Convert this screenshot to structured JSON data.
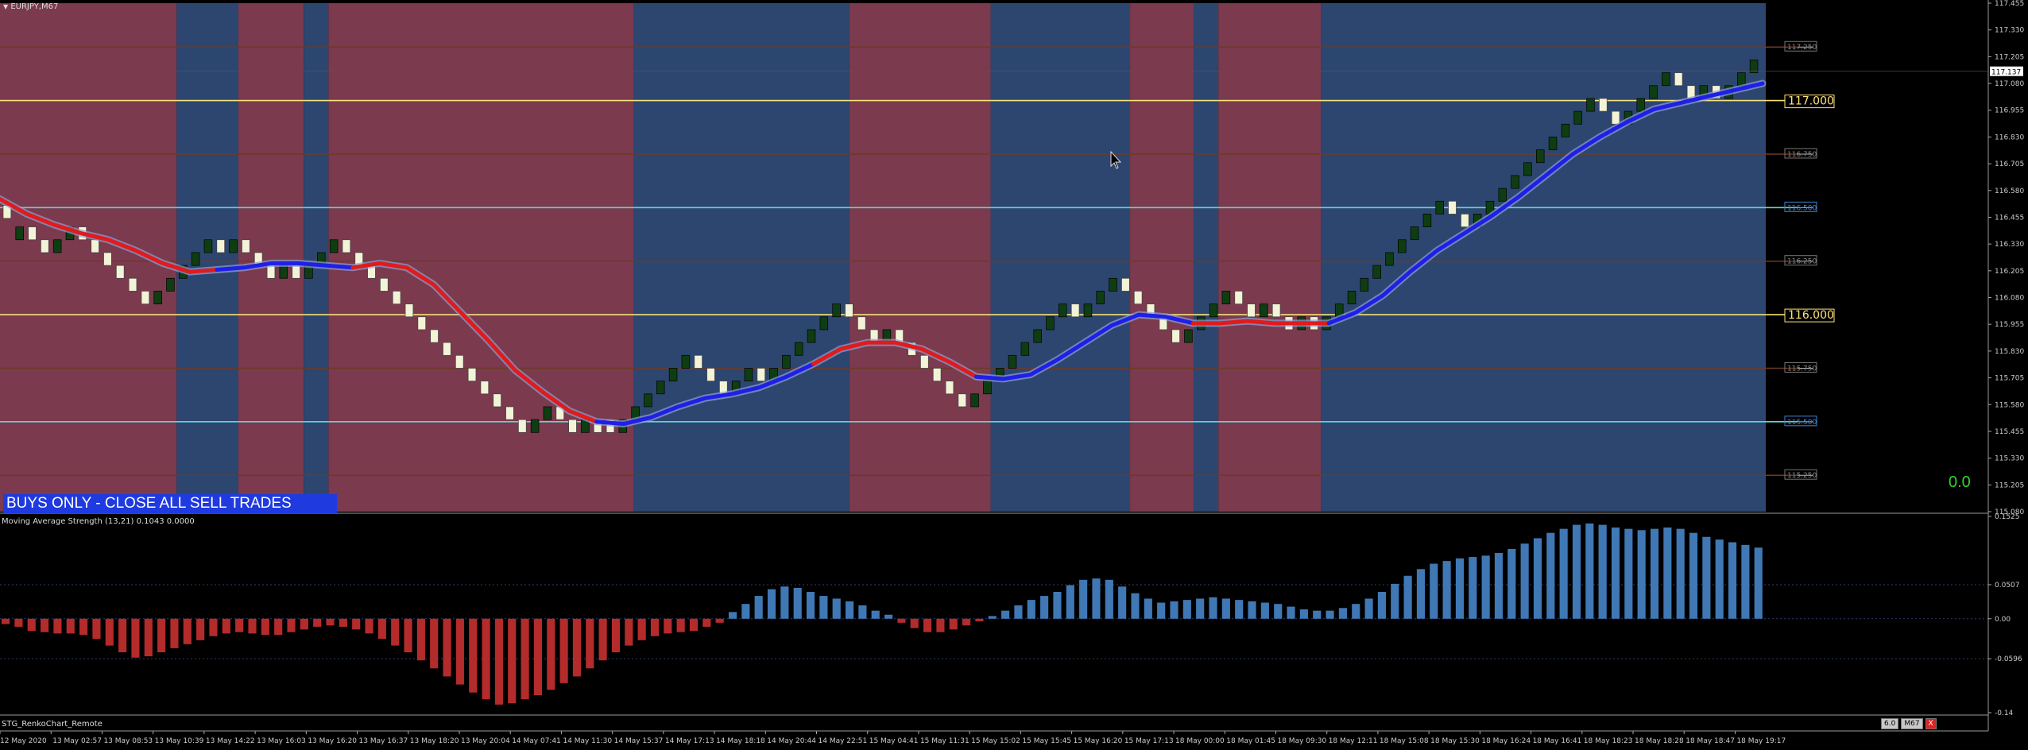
{
  "window": {
    "symbol_timeframe": "EURJPY,M67",
    "menu_arrow": "triangle-down-icon"
  },
  "banner": {
    "text": "BUYS ONLY - CLOSE ALL SELL TRADES",
    "bg": "#1f3adf"
  },
  "strength_readout": "0.0",
  "indicator": {
    "title": "Moving Average Strength (13,21) 0.1043 0.0000"
  },
  "ea": {
    "name": "STG_RenkoChart_Remote"
  },
  "controls": {
    "value": "6.0",
    "timeframe": "M67",
    "close": "X"
  },
  "colors": {
    "bull_brick": "#0f3d12",
    "bear_brick": "#f3f3d8",
    "ma_up": "#1f1fe8",
    "ma_down": "#e01b1b",
    "hist_pos": "#3f78b4",
    "hist_neg": "#b42b2b",
    "zone_red": "#7b3a4e",
    "zone_blue": "#2d4670",
    "level_yellow": "#f6e27a",
    "level_cyan": "#5fd6d6",
    "level_brown": "#6b3a26",
    "level_green": "#2b6b2b",
    "label_box": "#ffe37a"
  },
  "chart_data": [
    {
      "type": "line",
      "title": "EURJPY,M67",
      "ylim": [
        115.08,
        117.455
      ],
      "y_ticks": [
        "117.455",
        "117.330",
        "117.205",
        "117.080",
        "116.955",
        "116.830",
        "116.705",
        "116.580",
        "116.455",
        "116.330",
        "116.205",
        "116.080",
        "115.955",
        "115.830",
        "115.705",
        "115.580",
        "115.455",
        "115.330",
        "115.205",
        "115.080"
      ],
      "current_price": "117.137",
      "x_ticks": [
        "12 May 2020",
        "13 May 02:57",
        "13 May 08:53",
        "13 May 10:39",
        "13 May 14:22",
        "13 May 16:03",
        "13 May 16:20",
        "13 May 16:37",
        "13 May 18:20",
        "13 May 20:04",
        "14 May 07:41",
        "14 May 11:30",
        "14 May 15:37",
        "14 May 17:13",
        "14 May 18:18",
        "14 May 20:44",
        "14 May 22:51",
        "15 May 04:41",
        "15 May 11:31",
        "15 May 15:02",
        "15 May 15:45",
        "15 May 16:20",
        "15 May 17:13",
        "18 May 00:00",
        "18 May 01:45",
        "18 May 09:30",
        "18 May 12:11",
        "18 May 15:08",
        "18 May 15:30",
        "18 May 16:24",
        "18 May 16:41",
        "18 May 18:23",
        "18 May 18:28",
        "18 May 18:47",
        "18 May 19:17"
      ],
      "horizontal_levels": [
        {
          "price": 117.25,
          "label": "117.250",
          "style": "minor"
        },
        {
          "price": 117.0,
          "label": "117.000",
          "style": "major"
        },
        {
          "price": 116.75,
          "label": "116.750",
          "style": "minor"
        },
        {
          "price": 116.5,
          "label": "116.500",
          "style": "half"
        },
        {
          "price": 116.25,
          "label": "116.250",
          "style": "minor"
        },
        {
          "price": 116.0,
          "label": "116.000",
          "style": "major"
        },
        {
          "price": 115.75,
          "label": "115.750",
          "style": "minor"
        },
        {
          "price": 115.5,
          "label": "115.500",
          "style": "half"
        },
        {
          "price": 115.25,
          "label": "115.250",
          "style": "minor"
        }
      ],
      "renko_brick_size": 0.06,
      "renko_bricks": [
        {
          "d": -1,
          "c": 116.45
        },
        {
          "d": 1,
          "c": 116.41
        },
        {
          "d": -1,
          "c": 116.35
        },
        {
          "d": -1,
          "c": 116.29
        },
        {
          "d": 1,
          "c": 116.35
        },
        {
          "d": 1,
          "c": 116.41
        },
        {
          "d": -1,
          "c": 116.35
        },
        {
          "d": -1,
          "c": 116.29
        },
        {
          "d": -1,
          "c": 116.23
        },
        {
          "d": -1,
          "c": 116.17
        },
        {
          "d": -1,
          "c": 116.11
        },
        {
          "d": -1,
          "c": 116.05
        },
        {
          "d": 1,
          "c": 116.11
        },
        {
          "d": 1,
          "c": 116.17
        },
        {
          "d": 1,
          "c": 116.23
        },
        {
          "d": 1,
          "c": 116.29
        },
        {
          "d": 1,
          "c": 116.35
        },
        {
          "d": -1,
          "c": 116.29
        },
        {
          "d": 1,
          "c": 116.35
        },
        {
          "d": -1,
          "c": 116.29
        },
        {
          "d": -1,
          "c": 116.23
        },
        {
          "d": -1,
          "c": 116.17
        },
        {
          "d": 1,
          "c": 116.23
        },
        {
          "d": -1,
          "c": 116.17
        },
        {
          "d": 1,
          "c": 116.23
        },
        {
          "d": 1,
          "c": 116.29
        },
        {
          "d": 1,
          "c": 116.35
        },
        {
          "d": -1,
          "c": 116.29
        },
        {
          "d": -1,
          "c": 116.23
        },
        {
          "d": -1,
          "c": 116.17
        },
        {
          "d": -1,
          "c": 116.11
        },
        {
          "d": -1,
          "c": 116.05
        },
        {
          "d": -1,
          "c": 115.99
        },
        {
          "d": -1,
          "c": 115.93
        },
        {
          "d": -1,
          "c": 115.87
        },
        {
          "d": -1,
          "c": 115.81
        },
        {
          "d": -1,
          "c": 115.75
        },
        {
          "d": -1,
          "c": 115.69
        },
        {
          "d": -1,
          "c": 115.63
        },
        {
          "d": -1,
          "c": 115.57
        },
        {
          "d": -1,
          "c": 115.51
        },
        {
          "d": -1,
          "c": 115.45
        },
        {
          "d": 1,
          "c": 115.51
        },
        {
          "d": 1,
          "c": 115.57
        },
        {
          "d": -1,
          "c": 115.51
        },
        {
          "d": -1,
          "c": 115.45
        },
        {
          "d": 1,
          "c": 115.51
        },
        {
          "d": -1,
          "c": 115.45
        },
        {
          "d": -1,
          "c": 115.45
        },
        {
          "d": 1,
          "c": 115.51
        },
        {
          "d": 1,
          "c": 115.57
        },
        {
          "d": 1,
          "c": 115.63
        },
        {
          "d": 1,
          "c": 115.69
        },
        {
          "d": 1,
          "c": 115.75
        },
        {
          "d": 1,
          "c": 115.81
        },
        {
          "d": -1,
          "c": 115.75
        },
        {
          "d": -1,
          "c": 115.69
        },
        {
          "d": -1,
          "c": 115.63
        },
        {
          "d": 1,
          "c": 115.69
        },
        {
          "d": 1,
          "c": 115.75
        },
        {
          "d": -1,
          "c": 115.69
        },
        {
          "d": 1,
          "c": 115.75
        },
        {
          "d": 1,
          "c": 115.81
        },
        {
          "d": 1,
          "c": 115.87
        },
        {
          "d": 1,
          "c": 115.93
        },
        {
          "d": 1,
          "c": 115.99
        },
        {
          "d": 1,
          "c": 116.05
        },
        {
          "d": -1,
          "c": 115.99
        },
        {
          "d": -1,
          "c": 115.93
        },
        {
          "d": -1,
          "c": 115.87
        },
        {
          "d": 1,
          "c": 115.93
        },
        {
          "d": -1,
          "c": 115.87
        },
        {
          "d": -1,
          "c": 115.81
        },
        {
          "d": -1,
          "c": 115.75
        },
        {
          "d": -1,
          "c": 115.69
        },
        {
          "d": -1,
          "c": 115.63
        },
        {
          "d": -1,
          "c": 115.57
        },
        {
          "d": 1,
          "c": 115.63
        },
        {
          "d": 1,
          "c": 115.69
        },
        {
          "d": 1,
          "c": 115.75
        },
        {
          "d": 1,
          "c": 115.81
        },
        {
          "d": 1,
          "c": 115.87
        },
        {
          "d": 1,
          "c": 115.93
        },
        {
          "d": 1,
          "c": 115.99
        },
        {
          "d": 1,
          "c": 116.05
        },
        {
          "d": -1,
          "c": 115.99
        },
        {
          "d": 1,
          "c": 116.05
        },
        {
          "d": 1,
          "c": 116.11
        },
        {
          "d": 1,
          "c": 116.17
        },
        {
          "d": -1,
          "c": 116.11
        },
        {
          "d": -1,
          "c": 116.05
        },
        {
          "d": -1,
          "c": 115.99
        },
        {
          "d": -1,
          "c": 115.93
        },
        {
          "d": -1,
          "c": 115.87
        },
        {
          "d": 1,
          "c": 115.93
        },
        {
          "d": 1,
          "c": 115.99
        },
        {
          "d": 1,
          "c": 116.05
        },
        {
          "d": 1,
          "c": 116.11
        },
        {
          "d": -1,
          "c": 116.05
        },
        {
          "d": -1,
          "c": 115.99
        },
        {
          "d": 1,
          "c": 116.05
        },
        {
          "d": -1,
          "c": 115.99
        },
        {
          "d": -1,
          "c": 115.93
        },
        {
          "d": 1,
          "c": 115.99
        },
        {
          "d": -1,
          "c": 115.93
        },
        {
          "d": 1,
          "c": 115.99
        },
        {
          "d": 1,
          "c": 116.05
        },
        {
          "d": 1,
          "c": 116.11
        },
        {
          "d": 1,
          "c": 116.17
        },
        {
          "d": 1,
          "c": 116.23
        },
        {
          "d": 1,
          "c": 116.29
        },
        {
          "d": 1,
          "c": 116.35
        },
        {
          "d": 1,
          "c": 116.41
        },
        {
          "d": 1,
          "c": 116.47
        },
        {
          "d": 1,
          "c": 116.53
        },
        {
          "d": -1,
          "c": 116.47
        },
        {
          "d": -1,
          "c": 116.41
        },
        {
          "d": 1,
          "c": 116.47
        },
        {
          "d": 1,
          "c": 116.53
        },
        {
          "d": 1,
          "c": 116.59
        },
        {
          "d": 1,
          "c": 116.65
        },
        {
          "d": 1,
          "c": 116.71
        },
        {
          "d": 1,
          "c": 116.77
        },
        {
          "d": 1,
          "c": 116.83
        },
        {
          "d": 1,
          "c": 116.89
        },
        {
          "d": 1,
          "c": 116.95
        },
        {
          "d": 1,
          "c": 117.01
        },
        {
          "d": -1,
          "c": 116.95
        },
        {
          "d": -1,
          "c": 116.89
        },
        {
          "d": 1,
          "c": 116.95
        },
        {
          "d": 1,
          "c": 117.01
        },
        {
          "d": 1,
          "c": 117.07
        },
        {
          "d": 1,
          "c": 117.13
        },
        {
          "d": -1,
          "c": 117.07
        },
        {
          "d": -1,
          "c": 117.01
        },
        {
          "d": 1,
          "c": 117.07
        },
        {
          "d": -1,
          "c": 117.01
        },
        {
          "d": 1,
          "c": 117.07
        },
        {
          "d": 1,
          "c": 117.13
        },
        {
          "d": 1,
          "c": 117.19
        }
      ],
      "moving_average": [
        116.54,
        116.47,
        116.42,
        116.38,
        116.35,
        116.3,
        116.24,
        116.2,
        116.21,
        116.22,
        116.24,
        116.24,
        116.23,
        116.22,
        116.24,
        116.22,
        116.14,
        116.01,
        115.88,
        115.74,
        115.64,
        115.55,
        115.5,
        115.49,
        115.52,
        115.57,
        115.61,
        115.63,
        115.66,
        115.71,
        115.77,
        115.84,
        115.87,
        115.87,
        115.84,
        115.78,
        115.71,
        115.7,
        115.72,
        115.79,
        115.87,
        115.95,
        116.0,
        115.99,
        115.96,
        115.96,
        115.97,
        115.96,
        115.96,
        115.96,
        116.01,
        116.09,
        116.2,
        116.3,
        116.38,
        116.46,
        116.55,
        116.65,
        116.75,
        116.83,
        116.9,
        116.96,
        116.99,
        117.02,
        117.05,
        117.08
      ],
      "ma_color_segments": [
        {
          "from": 0,
          "to": 7,
          "color": "down"
        },
        {
          "from": 8,
          "to": 12,
          "color": "up"
        },
        {
          "from": 13,
          "to": 21,
          "color": "down"
        },
        {
          "from": 22,
          "to": 29,
          "color": "up"
        },
        {
          "from": 30,
          "to": 35,
          "color": "down"
        },
        {
          "from": 36,
          "to": 43,
          "color": "up"
        },
        {
          "from": 44,
          "to": 48,
          "color": "down"
        },
        {
          "from": 49,
          "to": 65,
          "color": "up"
        }
      ],
      "zones": [
        {
          "from": 0,
          "to": 0.1,
          "color": "red"
        },
        {
          "from": 0.1,
          "to": 0.135,
          "color": "blue"
        },
        {
          "from": 0.135,
          "to": 0.172,
          "color": "red"
        },
        {
          "from": 0.172,
          "to": 0.186,
          "color": "blue"
        },
        {
          "from": 0.186,
          "to": 0.359,
          "color": "red"
        },
        {
          "from": 0.359,
          "to": 0.481,
          "color": "blue"
        },
        {
          "from": 0.481,
          "to": 0.561,
          "color": "red"
        },
        {
          "from": 0.561,
          "to": 0.64,
          "color": "blue"
        },
        {
          "from": 0.64,
          "to": 0.676,
          "color": "red"
        },
        {
          "from": 0.676,
          "to": 0.69,
          "color": "blue"
        },
        {
          "from": 0.69,
          "to": 0.748,
          "color": "red"
        },
        {
          "from": 0.748,
          "to": 1.0,
          "color": "blue"
        }
      ]
    },
    {
      "type": "bar",
      "title": "Moving Average Strength (13,21) 0.1043 0.0000",
      "ylim": [
        -0.14,
        0.1525
      ],
      "y_ticks": [
        "0.1525",
        "0.0507",
        "0.00",
        "-0.0596",
        "-0.14"
      ],
      "values": [
        -0.008,
        -0.012,
        -0.018,
        -0.02,
        -0.022,
        -0.022,
        -0.024,
        -0.03,
        -0.04,
        -0.05,
        -0.058,
        -0.056,
        -0.05,
        -0.044,
        -0.038,
        -0.032,
        -0.026,
        -0.022,
        -0.02,
        -0.022,
        -0.024,
        -0.024,
        -0.02,
        -0.016,
        -0.012,
        -0.01,
        -0.012,
        -0.016,
        -0.022,
        -0.03,
        -0.04,
        -0.05,
        -0.062,
        -0.074,
        -0.086,
        -0.098,
        -0.11,
        -0.12,
        -0.128,
        -0.126,
        -0.12,
        -0.114,
        -0.106,
        -0.096,
        -0.086,
        -0.074,
        -0.062,
        -0.05,
        -0.04,
        -0.032,
        -0.026,
        -0.022,
        -0.02,
        -0.018,
        -0.012,
        -0.006,
        0.01,
        0.022,
        0.034,
        0.044,
        0.048,
        0.046,
        0.04,
        0.034,
        0.03,
        0.026,
        0.02,
        0.012,
        0.006,
        -0.006,
        -0.014,
        -0.02,
        -0.02,
        -0.016,
        -0.01,
        -0.004,
        0.004,
        0.012,
        0.02,
        0.028,
        0.034,
        0.04,
        0.05,
        0.058,
        0.06,
        0.058,
        0.048,
        0.038,
        0.03,
        0.024,
        0.026,
        0.028,
        0.03,
        0.032,
        0.03,
        0.028,
        0.026,
        0.024,
        0.022,
        0.018,
        0.014,
        0.012,
        0.012,
        0.016,
        0.022,
        0.03,
        0.04,
        0.052,
        0.064,
        0.074,
        0.082,
        0.086,
        0.09,
        0.092,
        0.094,
        0.098,
        0.104,
        0.112,
        0.12,
        0.128,
        0.134,
        0.14,
        0.142,
        0.14,
        0.136,
        0.134,
        0.132,
        0.134,
        0.136,
        0.134,
        0.128,
        0.122,
        0.118,
        0.114,
        0.11,
        0.106
      ]
    }
  ]
}
